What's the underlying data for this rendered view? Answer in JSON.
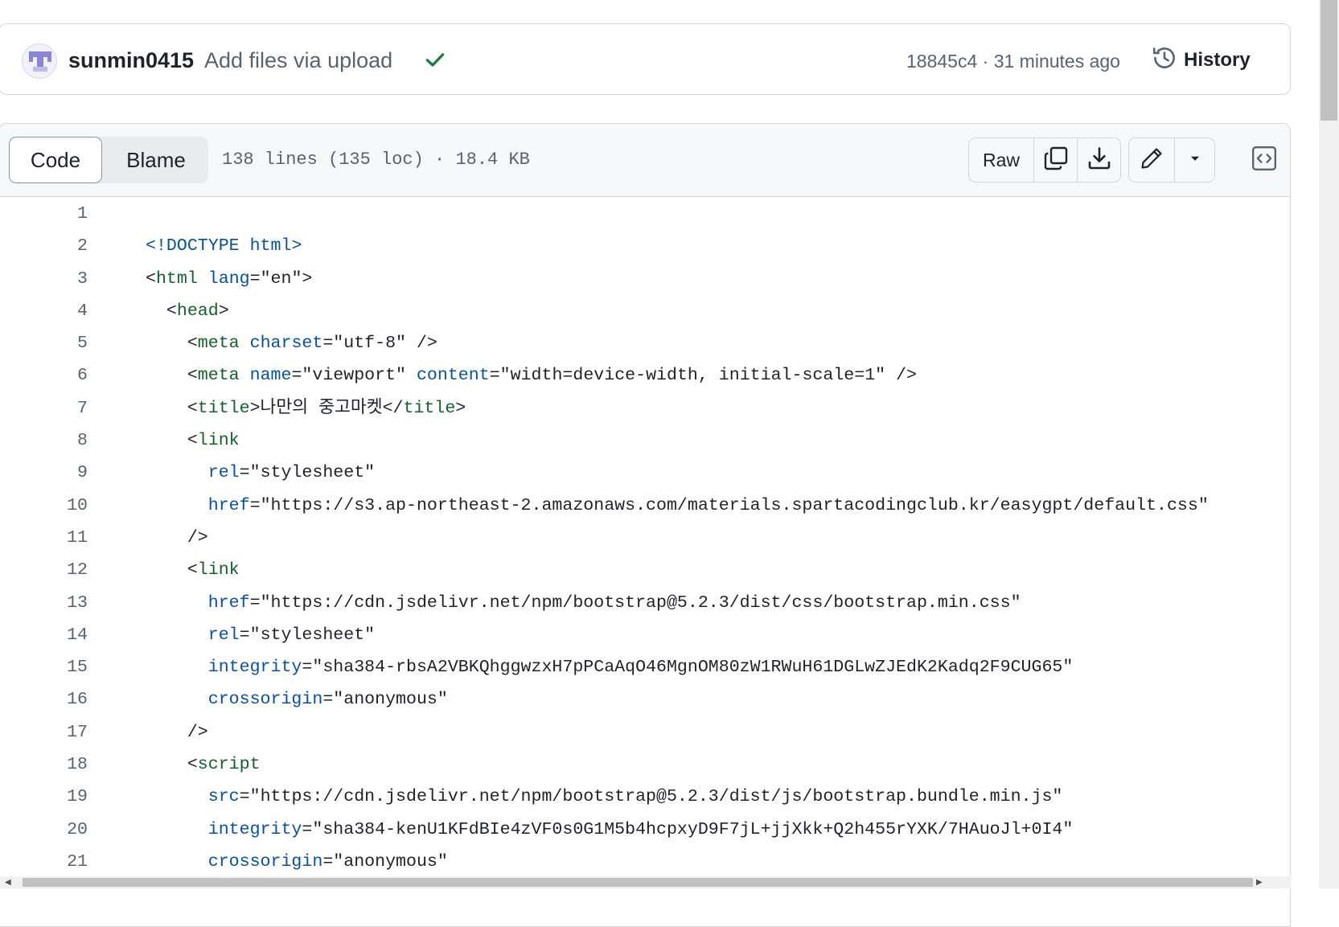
{
  "commit": {
    "author": "sunmin0415",
    "message": "Add files via upload",
    "sha": "18845c4",
    "separator": " · ",
    "time": "31 minutes ago",
    "history_label": "History",
    "status_color": "#1a7f37"
  },
  "file_header": {
    "tabs": {
      "code": "Code",
      "blame": "Blame"
    },
    "meta": "138 lines (135 loc) · 18.4 KB",
    "raw_label": "Raw"
  },
  "code_lines": [
    {
      "n": "1",
      "tokens": []
    },
    {
      "n": "2",
      "tokens": [
        {
          "t": "<!DOCTYPE html>",
          "c": "at"
        }
      ]
    },
    {
      "n": "3",
      "tokens": [
        {
          "t": "<"
        },
        {
          "t": "html",
          "c": "tg"
        },
        {
          "t": " "
        },
        {
          "t": "lang",
          "c": "at"
        },
        {
          "t": "=\"en\">"
        }
      ]
    },
    {
      "n": "4",
      "tokens": [
        {
          "t": "  <"
        },
        {
          "t": "head",
          "c": "tg"
        },
        {
          "t": ">"
        }
      ]
    },
    {
      "n": "5",
      "tokens": [
        {
          "t": "    <"
        },
        {
          "t": "meta",
          "c": "tg"
        },
        {
          "t": " "
        },
        {
          "t": "charset",
          "c": "at"
        },
        {
          "t": "=\"utf-8\" />"
        }
      ]
    },
    {
      "n": "6",
      "tokens": [
        {
          "t": "    <"
        },
        {
          "t": "meta",
          "c": "tg"
        },
        {
          "t": " "
        },
        {
          "t": "name",
          "c": "at"
        },
        {
          "t": "=\"viewport\" "
        },
        {
          "t": "content",
          "c": "at"
        },
        {
          "t": "=\"width=device-width, initial-scale=1\" />"
        }
      ]
    },
    {
      "n": "7",
      "tokens": [
        {
          "t": "    <"
        },
        {
          "t": "title",
          "c": "tg"
        },
        {
          "t": ">나만의 중고마켓</"
        },
        {
          "t": "title",
          "c": "tg"
        },
        {
          "t": ">"
        }
      ]
    },
    {
      "n": "8",
      "tokens": [
        {
          "t": "    <"
        },
        {
          "t": "link",
          "c": "tg"
        }
      ]
    },
    {
      "n": "9",
      "tokens": [
        {
          "t": "      "
        },
        {
          "t": "rel",
          "c": "at"
        },
        {
          "t": "=\"stylesheet\""
        }
      ]
    },
    {
      "n": "10",
      "tokens": [
        {
          "t": "      "
        },
        {
          "t": "href",
          "c": "at"
        },
        {
          "t": "=\"https://s3.ap-northeast-2.amazonaws.com/materials.spartacodingclub.kr/easygpt/default.css\""
        }
      ]
    },
    {
      "n": "11",
      "tokens": [
        {
          "t": "    />"
        }
      ]
    },
    {
      "n": "12",
      "tokens": [
        {
          "t": "    <"
        },
        {
          "t": "link",
          "c": "tg"
        }
      ]
    },
    {
      "n": "13",
      "tokens": [
        {
          "t": "      "
        },
        {
          "t": "href",
          "c": "at"
        },
        {
          "t": "=\"https://cdn.jsdelivr.net/npm/bootstrap@5.2.3/dist/css/bootstrap.min.css\""
        }
      ]
    },
    {
      "n": "14",
      "tokens": [
        {
          "t": "      "
        },
        {
          "t": "rel",
          "c": "at"
        },
        {
          "t": "=\"stylesheet\""
        }
      ]
    },
    {
      "n": "15",
      "tokens": [
        {
          "t": "      "
        },
        {
          "t": "integrity",
          "c": "at"
        },
        {
          "t": "=\"sha384-rbsA2VBKQhggwzxH7pPCaAqO46MgnOM80zW1RWuH61DGLwZJEdK2Kadq2F9CUG65\""
        }
      ]
    },
    {
      "n": "16",
      "tokens": [
        {
          "t": "      "
        },
        {
          "t": "crossorigin",
          "c": "at"
        },
        {
          "t": "=\"anonymous\""
        }
      ]
    },
    {
      "n": "17",
      "tokens": [
        {
          "t": "    />"
        }
      ]
    },
    {
      "n": "18",
      "tokens": [
        {
          "t": "    <"
        },
        {
          "t": "script",
          "c": "tg"
        }
      ]
    },
    {
      "n": "19",
      "tokens": [
        {
          "t": "      "
        },
        {
          "t": "src",
          "c": "at"
        },
        {
          "t": "=\"https://cdn.jsdelivr.net/npm/bootstrap@5.2.3/dist/js/bootstrap.bundle.min.js\""
        }
      ]
    },
    {
      "n": "20",
      "tokens": [
        {
          "t": "      "
        },
        {
          "t": "integrity",
          "c": "at"
        },
        {
          "t": "=\"sha384-kenU1KFdBIe4zVF0s0G1M5b4hcpxyD9F7jL+jjXkk+Q2h455rYXK/7HAuoJl+0I4\""
        }
      ]
    },
    {
      "n": "21",
      "tokens": [
        {
          "t": "      "
        },
        {
          "t": "crossorigin",
          "c": "at"
        },
        {
          "t": "=\"anonymous\""
        }
      ]
    }
  ],
  "icons": {
    "avatar": "identicon-avatar",
    "status": "check-icon",
    "history": "history-icon",
    "copy": "copy-icon",
    "download": "download-icon",
    "edit": "pencil-icon",
    "more": "triangle-down-icon",
    "symbols": "code-square-icon"
  }
}
